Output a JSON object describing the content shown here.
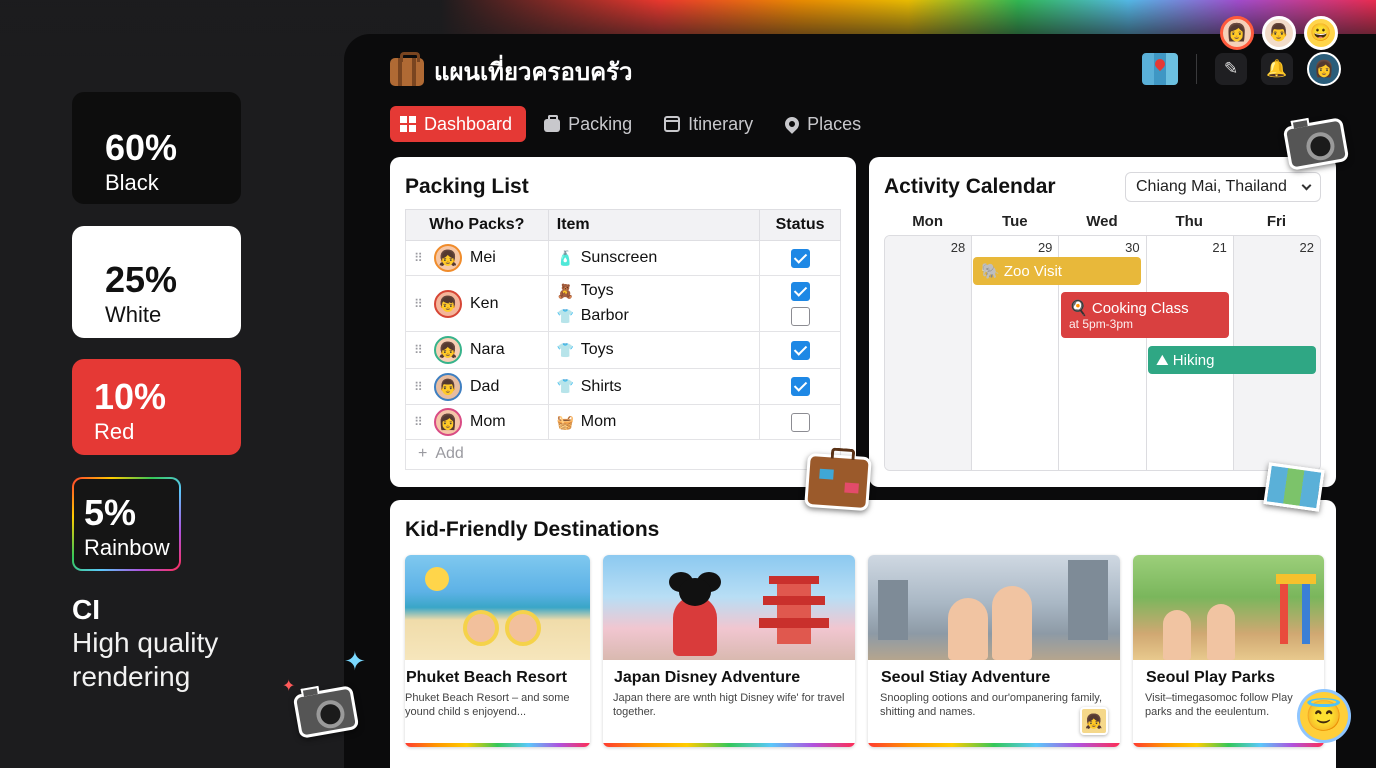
{
  "swatches": [
    {
      "pct": "60%",
      "label": "Black"
    },
    {
      "pct": "25%",
      "label": "White"
    },
    {
      "pct": "10%",
      "label": "Red"
    },
    {
      "pct": "5%",
      "label": "Rainbow"
    }
  ],
  "ci": {
    "title": "CI",
    "subtitle": "High quality rendering"
  },
  "app": {
    "title": "แผนเที่ยวครอบครัว",
    "icons": [
      "map-icon",
      "edit-icon",
      "bell-icon",
      "user-avatar"
    ]
  },
  "tabs": [
    {
      "label": "Dashboard",
      "icon": "grid-icon",
      "active": true
    },
    {
      "label": "Packing",
      "icon": "bag-icon",
      "active": false
    },
    {
      "label": "Itinerary",
      "icon": "calendar-icon",
      "active": false
    },
    {
      "label": "Places",
      "icon": "pin-icon",
      "active": false
    }
  ],
  "packing": {
    "title": "Packing List",
    "columns": [
      "Who Packs?",
      "Item",
      "Status"
    ],
    "rows": [
      {
        "who": "Mei",
        "items": [
          {
            "name": "Sunscreen",
            "icon": "🧴",
            "checked": true
          }
        ]
      },
      {
        "who": "Ken",
        "items": [
          {
            "name": "Toys",
            "icon": "🧸",
            "checked": true
          },
          {
            "name": "Barbor",
            "icon": "👕",
            "checked": false
          }
        ]
      },
      {
        "who": "Nara",
        "items": [
          {
            "name": "Toys",
            "icon": "👕",
            "checked": true
          }
        ]
      },
      {
        "who": "Dad",
        "items": [
          {
            "name": "Shirts",
            "icon": "👕",
            "checked": true
          }
        ]
      },
      {
        "who": "Mom",
        "items": [
          {
            "name": "Mom",
            "icon": "🧺",
            "checked": false
          }
        ]
      }
    ],
    "add_label": "Add"
  },
  "calendar": {
    "title": "Activity Calendar",
    "location": "Chiang Mai, Thailand",
    "days": [
      "Mon",
      "Tue",
      "Wed",
      "Thu",
      "Fri"
    ],
    "dates": [
      "28",
      "29",
      "30",
      "21",
      "22"
    ],
    "events": [
      {
        "name": "Zoo Visit",
        "icon": "🐘",
        "color": "#e8b83a"
      },
      {
        "name": "Cooking Class",
        "icon": "🍳",
        "time": "at 5pm-3pm",
        "color": "#d94040"
      },
      {
        "name": "Hiking",
        "icon": "⛰",
        "color": "#2fa784"
      }
    ]
  },
  "destinations": {
    "title": "Kid-Friendly Destinations",
    "items": [
      {
        "name": "Phuket Beach Resort",
        "desc": "Phuket Beach Resort – and some yound child s enjoyend..."
      },
      {
        "name": "Japan Disney Adventure",
        "desc": "Japan there are wnth higt Disney wife' for travel together."
      },
      {
        "name": "Seoul Stiay Adventure",
        "desc": "Snoopling ootions and our'ompanering family, shitting and names."
      },
      {
        "name": "Seoul Play Parks",
        "desc": "Visit–timegasomoc follow Play parks and the eeulentum."
      }
    ]
  },
  "colors": {
    "accent": "#e53935",
    "check": "#1e88e5",
    "background": "#0b0b0c"
  }
}
